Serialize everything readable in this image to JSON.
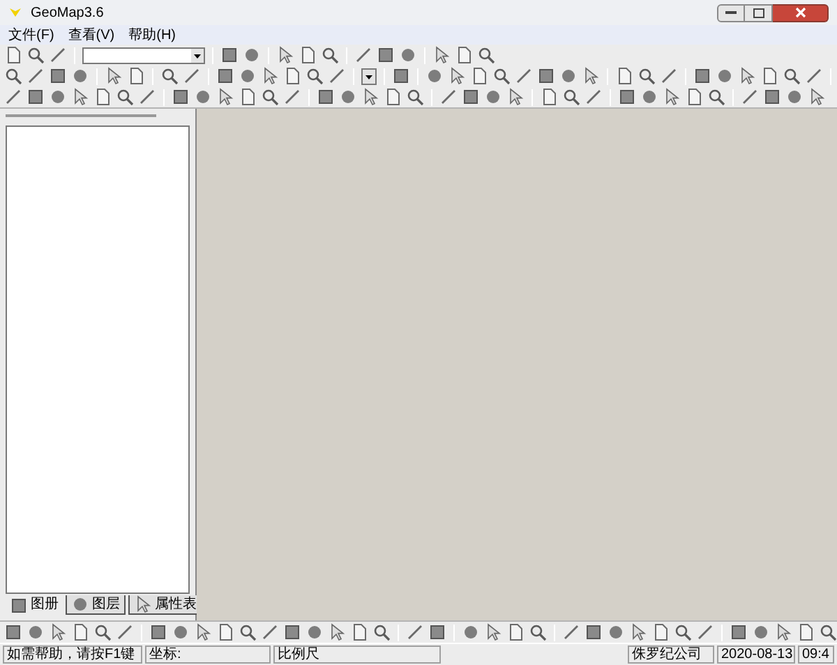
{
  "window": {
    "title": "GeoMap3.6"
  },
  "menu": [
    "文件(F)",
    "查看(V)",
    "帮助(H)"
  ],
  "tabs": [
    {
      "label": "图册",
      "selected": true
    },
    {
      "label": "图层",
      "selected": false
    },
    {
      "label": "属性表",
      "selected": false
    }
  ],
  "status_bar": [
    "如需帮助，请按F1键",
    "坐标:",
    "比例尺",
    "侏罗纪公司",
    "2020-08-13",
    "09:4"
  ]
}
